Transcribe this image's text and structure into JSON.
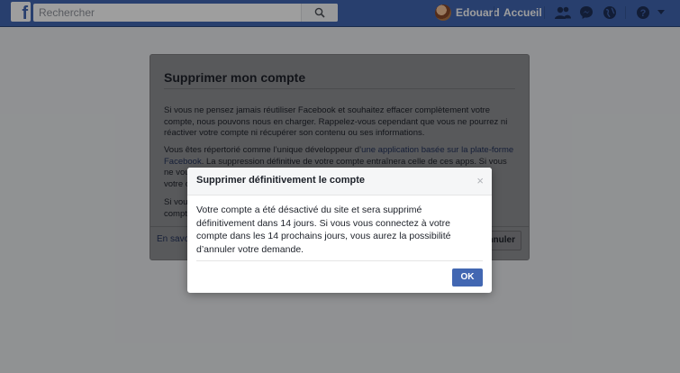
{
  "header": {
    "logo": "f",
    "search_placeholder": "Rechercher",
    "user_name": "Edouard",
    "home_label": "Accueil",
    "icons": [
      "friends-icon",
      "messenger-icon",
      "notifications-globe-icon",
      "help-icon",
      "chevron-down-icon"
    ],
    "brand_color": "#4267b2"
  },
  "card": {
    "title": "Supprimer mon compte",
    "para1": "Si vous ne pensez jamais réutiliser Facebook et souhaitez effacer complètement votre compte, nous pouvons nous en charger. Rappelez-vous cependant que vous ne pourrez ni réactiver votre compte ni récupérer son contenu ou ses informations.",
    "para2_prefix": "Vous êtes répertorié comme l’unique développeur d’",
    "para2_link": "une application basée sur la plate-forme Facebook",
    "para2_suffix": ". La suppression définitive de votre compte entraînera celle de ces apps. Si vous ne vous",
    "para2_tail": "votre c",
    "para3": "Si vou",
    "para3_line2": "compt",
    "footer_link": "En savo",
    "cancel_label": "Annuler",
    "right_fragment": "r"
  },
  "modal": {
    "title": "Supprimer définitivement le compte",
    "close_glyph": "×",
    "body": "Votre compte a été désactivé du site et sera supprimé définitivement dans 14 jours. Si vous vous connectez à votre compte dans les 14 prochains jours, vous aurez la possibilité d’annuler votre demande.",
    "ok_label": "OK"
  }
}
